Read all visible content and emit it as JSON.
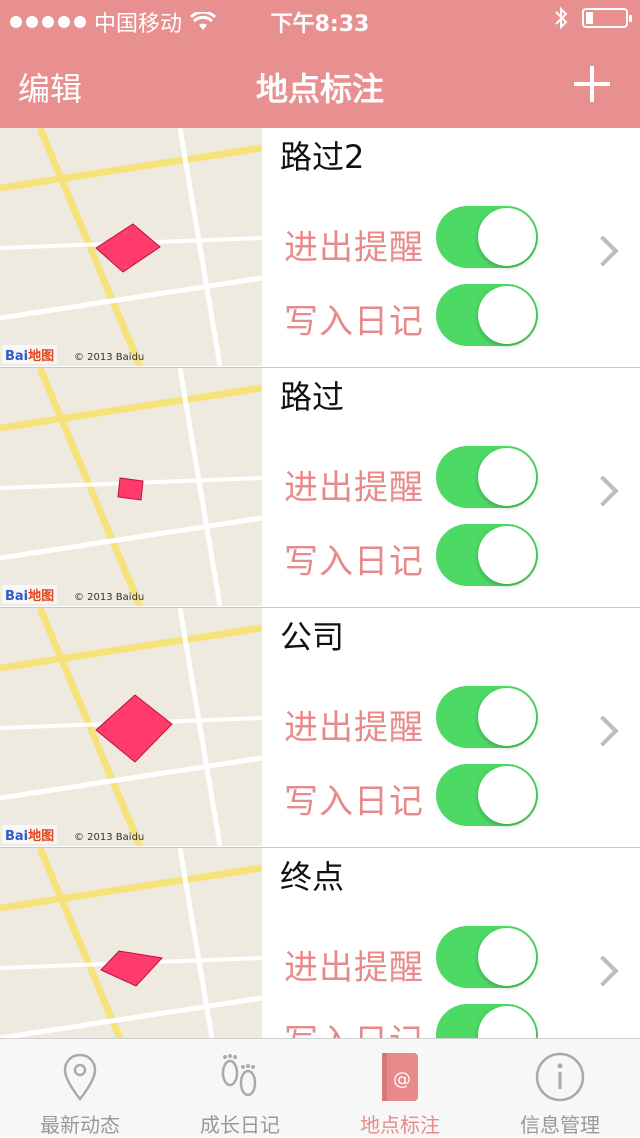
{
  "status": {
    "carrier": "中国移动",
    "time": "下午8:33",
    "battery_level": 0.18
  },
  "nav": {
    "edit_label": "编辑",
    "title": "地点标注"
  },
  "map_labels": {
    "logo": "Bai",
    "logo_suffix": "地图",
    "copyright": "© 2013 Baidu"
  },
  "rows": [
    {
      "name": "路过2",
      "reminder_label": "进出提醒",
      "diary_label": "写入日记",
      "reminder_on": true,
      "diary_on": true
    },
    {
      "name": "路过",
      "reminder_label": "进出提醒",
      "diary_label": "写入日记",
      "reminder_on": true,
      "diary_on": true
    },
    {
      "name": "公司",
      "reminder_label": "进出提醒",
      "diary_label": "写入日记",
      "reminder_on": true,
      "diary_on": true
    },
    {
      "name": "终点",
      "reminder_label": "进出提醒",
      "diary_label": "写入日记",
      "reminder_on": true,
      "diary_on": true
    }
  ],
  "tabs": [
    {
      "label": "最新动态",
      "icon": "location-pin-icon",
      "active": false
    },
    {
      "label": "成长日记",
      "icon": "footprints-icon",
      "active": false
    },
    {
      "label": "地点标注",
      "icon": "at-book-icon",
      "active": true
    },
    {
      "label": "信息管理",
      "icon": "info-icon",
      "active": false
    }
  ],
  "colors": {
    "header": "#e89090",
    "accent": "#e88a8a",
    "toggle_on": "#4cd964",
    "marker": "#ff3b6b"
  }
}
